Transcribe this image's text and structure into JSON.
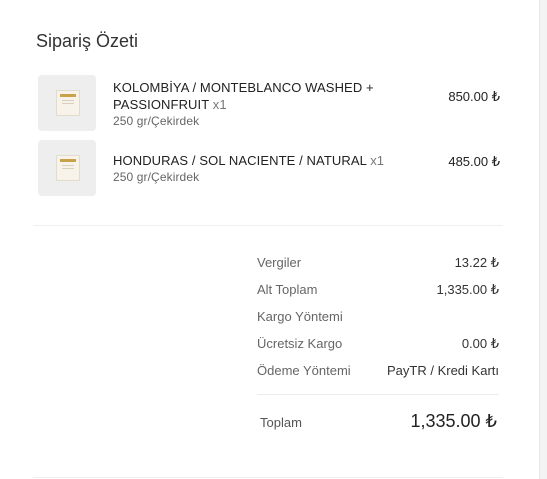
{
  "summary": {
    "title": "Sipariş Özeti"
  },
  "items": [
    {
      "name": "KOLOMBİYA / MONTEBLANCO WASHED + PASSIONFRUIT",
      "qty": "x1",
      "variant": "250 gr/Çekirdek",
      "price": "850.00 ₺"
    },
    {
      "name": "HONDURAS / SOL NACIENTE / NATURAL",
      "qty": "x1",
      "variant": "250 gr/Çekirdek",
      "price": "485.00 ₺"
    }
  ],
  "totals": {
    "taxes_label": "Vergiler",
    "taxes_value": "13.22 ₺",
    "subtotal_label": "Alt Toplam",
    "subtotal_value": "1,335.00 ₺",
    "shipping_method_label": "Kargo Yöntemi",
    "free_shipping_label": "Ücretsiz Kargo",
    "free_shipping_value": "0.00 ₺",
    "payment_method_label": "Ödeme Yöntemi",
    "payment_method_value": "PayTR / Kredi Kartı",
    "total_label": "Toplam",
    "total_value": "1,335.00 ₺"
  },
  "icons": {
    "product_thumbnail": "coffee-bag-image"
  }
}
